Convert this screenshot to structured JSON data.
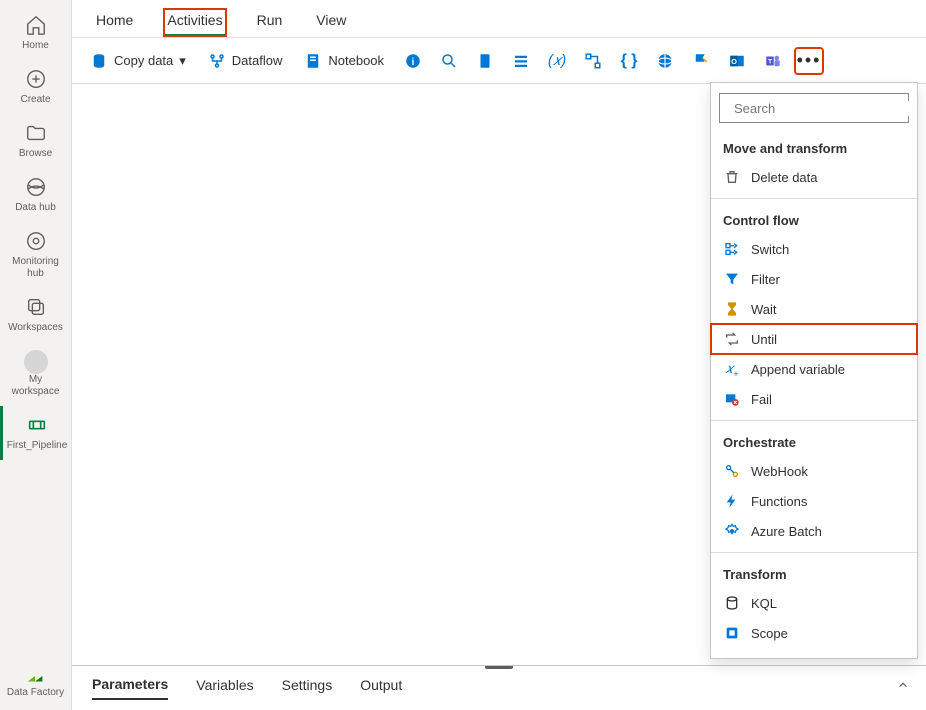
{
  "sidebar": {
    "items": [
      {
        "label": "Home"
      },
      {
        "label": "Create"
      },
      {
        "label": "Browse"
      },
      {
        "label": "Data hub"
      },
      {
        "label": "Monitoring hub"
      },
      {
        "label": "Workspaces"
      },
      {
        "label": "My workspace"
      },
      {
        "label": "First_Pipeline"
      }
    ],
    "bottom": {
      "label": "Data Factory"
    }
  },
  "tabs": [
    {
      "label": "Home"
    },
    {
      "label": "Activities"
    },
    {
      "label": "Run"
    },
    {
      "label": "View"
    }
  ],
  "toolbar": {
    "copy_data": "Copy data",
    "dataflow": "Dataflow",
    "notebook": "Notebook"
  },
  "dropdown": {
    "search_placeholder": "Search",
    "sections": {
      "move": {
        "title": "Move and transform",
        "items": [
          {
            "label": "Delete data"
          }
        ]
      },
      "control": {
        "title": "Control flow",
        "items": [
          {
            "label": "Switch"
          },
          {
            "label": "Filter"
          },
          {
            "label": "Wait"
          },
          {
            "label": "Until"
          },
          {
            "label": "Append variable"
          },
          {
            "label": "Fail"
          }
        ]
      },
      "orchestrate": {
        "title": "Orchestrate",
        "items": [
          {
            "label": "WebHook"
          },
          {
            "label": "Functions"
          },
          {
            "label": "Azure Batch"
          }
        ]
      },
      "transform": {
        "title": "Transform",
        "items": [
          {
            "label": "KQL"
          },
          {
            "label": "Scope"
          }
        ]
      }
    }
  },
  "bottom_panel": {
    "tabs": [
      {
        "label": "Parameters"
      },
      {
        "label": "Variables"
      },
      {
        "label": "Settings"
      },
      {
        "label": "Output"
      }
    ]
  }
}
